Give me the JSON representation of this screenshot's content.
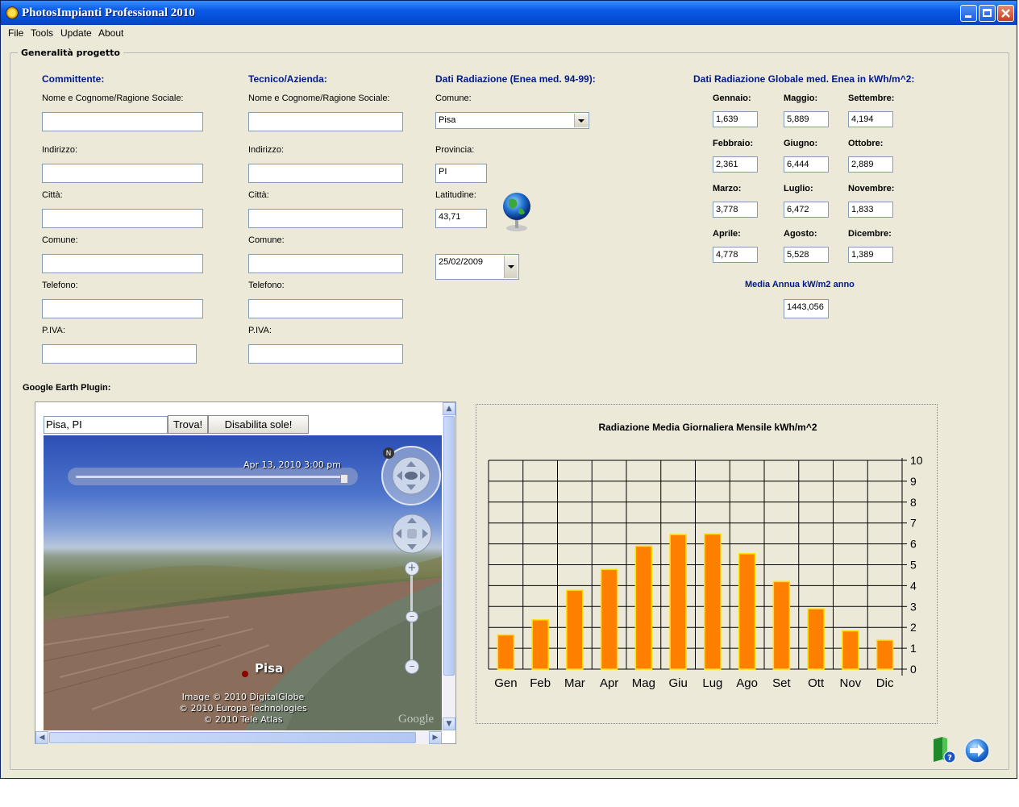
{
  "window": {
    "title": "PhotosImpianti Professional 2010"
  },
  "menu": [
    "File",
    "Tools",
    "Update",
    "About"
  ],
  "group_title": "Generalità progetto",
  "committente": {
    "header": "Committente:",
    "fields": [
      {
        "label": "Nome e Cognome/Ragione Sociale:",
        "value": ""
      },
      {
        "label": "Indirizzo:",
        "value": ""
      },
      {
        "label": "Città:",
        "value": ""
      },
      {
        "label": "Comune:",
        "value": ""
      },
      {
        "label": "Telefono:",
        "value": ""
      },
      {
        "label": "P.IVA:",
        "value": ""
      }
    ]
  },
  "tecnico": {
    "header": "Tecnico/Azienda:",
    "fields": [
      {
        "label": "Nome e Cognome/Ragione Sociale:",
        "value": ""
      },
      {
        "label": "Indirizzo:",
        "value": ""
      },
      {
        "label": "Città:",
        "value": ""
      },
      {
        "label": "Comune:",
        "value": ""
      },
      {
        "label": "Telefono:",
        "value": ""
      },
      {
        "label": "P.IVA:",
        "value": ""
      }
    ]
  },
  "radiazione": {
    "header": "Dati Radiazione (Enea med. 94-99):",
    "comune_label": "Comune:",
    "comune_value": "Pisa",
    "provincia_label": "Provincia:",
    "provincia_value": "PI",
    "latitudine_label": "Latitudine:",
    "latitudine_value": "43,71",
    "date_value": "25/02/2009"
  },
  "globale": {
    "header": "Dati Radiazione Globale med. Enea in kWh/m^2:",
    "months": [
      {
        "label": "Gennaio:",
        "value": "1,639"
      },
      {
        "label": "Maggio:",
        "value": "5,889"
      },
      {
        "label": "Settembre:",
        "value": "4,194"
      },
      {
        "label": "Febbraio:",
        "value": "2,361"
      },
      {
        "label": "Giugno:",
        "value": "6,444"
      },
      {
        "label": "Ottobre:",
        "value": "2,889"
      },
      {
        "label": "Marzo:",
        "value": "3,778"
      },
      {
        "label": "Luglio:",
        "value": "6,472"
      },
      {
        "label": "Novembre:",
        "value": "1,833"
      },
      {
        "label": "Aprile:",
        "value": "4,778"
      },
      {
        "label": "Agosto:",
        "value": "5,528"
      },
      {
        "label": "Dicembre:",
        "value": "1,389"
      }
    ],
    "media_label": "Media Annua kW/m2 anno",
    "media_value": "1443,056"
  },
  "earth": {
    "label": "Google Earth Plugin:",
    "search_value": "Pisa, PI",
    "find_button": "Trova!",
    "sun_button": "Disabilita sole!",
    "time_text": "Apr 13, 2010   3:00 pm",
    "place_label": "Pisa",
    "credits": [
      "Image © 2010 DigitalGlobe",
      "© 2010 Europa Technologies",
      "© 2010 Tele Atlas"
    ],
    "logo": "Google"
  },
  "colors": {
    "bar_fill": "#ff8000",
    "bar_edge": "#ffe000",
    "title_bar": "#0a5ae6",
    "header_text": "#001a8c"
  },
  "chart_data": {
    "type": "bar",
    "title": "Radiazione Media Giornaliera Mensile kWh/m^2",
    "categories": [
      "Gen",
      "Feb",
      "Mar",
      "Apr",
      "Mag",
      "Giu",
      "Lug",
      "Ago",
      "Set",
      "Ott",
      "Nov",
      "Dic"
    ],
    "values": [
      1.639,
      2.361,
      3.778,
      4.778,
      5.889,
      6.444,
      6.472,
      5.528,
      4.194,
      2.889,
      1.833,
      1.389
    ],
    "ylim": [
      0,
      10
    ],
    "yticks": [
      "0",
      "1",
      "2",
      "3",
      "4",
      "5",
      "6",
      "7",
      "8",
      "9",
      "10"
    ],
    "y_axis_side": "right",
    "grid": true
  }
}
